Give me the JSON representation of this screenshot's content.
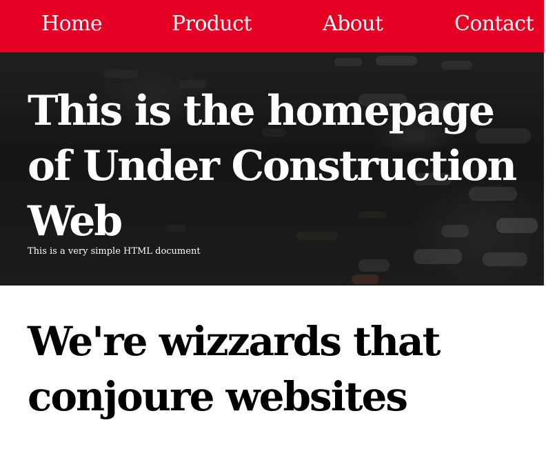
{
  "nav": {
    "items": [
      {
        "label": "Home"
      },
      {
        "label": "Product"
      },
      {
        "label": "About"
      },
      {
        "label": "Contact"
      }
    ],
    "background_color": "#e60023"
  },
  "hero": {
    "title": "This is the homepage of Under Construction Web",
    "subtitle": "This is a very simple HTML document"
  },
  "main": {
    "heading": "We're wizzards that conjoure websites"
  },
  "colors": {
    "accent": "#e60023",
    "hero_text": "#ffffff",
    "body_text": "#000000"
  }
}
